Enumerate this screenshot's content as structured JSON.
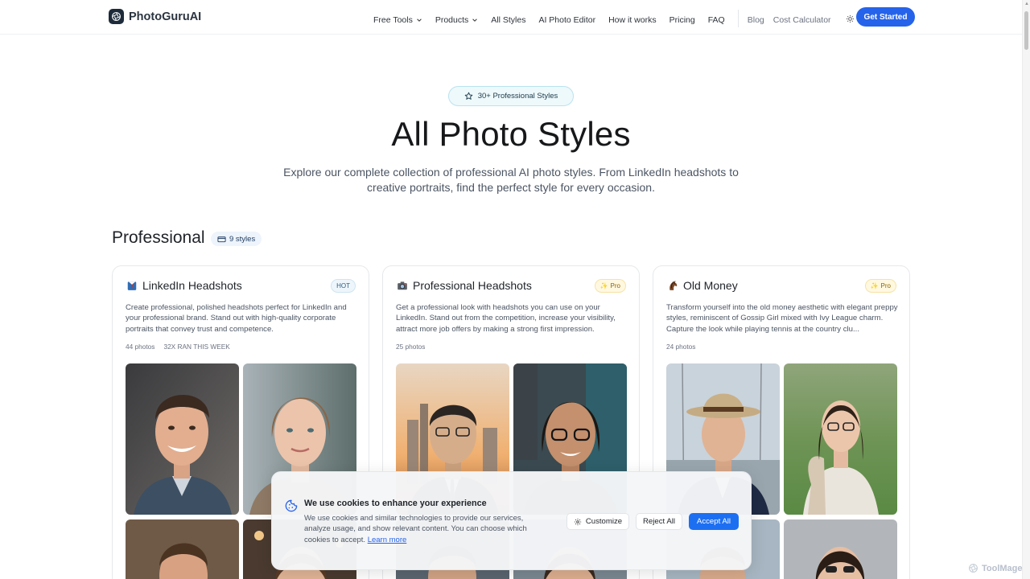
{
  "nav": {
    "brand": "PhotoGuruAI",
    "links": [
      "Free Tools",
      "Products",
      "All Styles",
      "AI Photo Editor",
      "How it works",
      "Pricing",
      "FAQ"
    ],
    "secondary": [
      "Blog",
      "Cost Calculator"
    ],
    "cta": "Get Started"
  },
  "hero": {
    "badge": "30+ Professional Styles",
    "title": "All Photo Styles",
    "subtitle": "Explore our complete collection of professional AI photo styles. From LinkedIn headshots to creative portraits, find the perfect style for every occasion."
  },
  "section": {
    "title": "Professional",
    "count": "9 styles"
  },
  "cards": [
    {
      "title": "LinkedIn Headshots",
      "tag": "HOT",
      "description": "Create professional, polished headshots perfect for LinkedIn and your professional brand. Stand out with high-quality corporate portraits that convey trust and competence.",
      "photos": "44 photos",
      "extra": "32X RAN THIS WEEK"
    },
    {
      "title": "Professional Headshots",
      "tag": "Pro",
      "description": "Get a professional look with headshots you can use on your LinkedIn. Stand out from the competition, increase your visibility, attract more job offers by making a strong first impression.",
      "photos": "25 photos",
      "extra": ""
    },
    {
      "title": "Old Money",
      "tag": "Pro",
      "description": "Transform yourself into the old money aesthetic with elegant preppy styles, reminiscent of Gossip Girl mixed with Ivy League charm. Capture the look while playing tennis at the country clu...",
      "photos": "24 photos",
      "extra": ""
    }
  ],
  "cookie": {
    "title": "We use cookies to enhance your experience",
    "text": "We use cookies and similar technologies to provide our services, analyze usage, and show relevant content. You can choose which cookies to accept.",
    "link": "Learn more",
    "customize": "Customize",
    "reject": "Reject All",
    "accept": "Accept All"
  },
  "watermark": "ToolMage",
  "colors": {
    "accent": "#2563eb",
    "badge_bg": "#eef9fc",
    "pro_tag": "#fff8e1"
  }
}
